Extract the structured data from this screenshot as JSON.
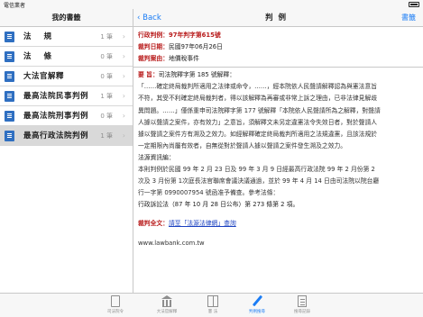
{
  "status": {
    "carrier": "電信業者",
    "time": ""
  },
  "sidebar": {
    "title": "我的書籤",
    "items": [
      {
        "label": "法規",
        "count": "1 筆"
      },
      {
        "label": "法條",
        "count": "0 筆"
      },
      {
        "label": "大法官解釋",
        "count": "0 筆"
      },
      {
        "label": "最高法院民事判例",
        "count": "1 筆"
      },
      {
        "label": "最高法院刑事判例",
        "count": "0 筆"
      },
      {
        "label": "最高行政法院判例",
        "count": "1 筆"
      }
    ]
  },
  "navbar": {
    "back": "Back",
    "title": "判例",
    "bookshelf": "書籤"
  },
  "case": {
    "type_label": "行政判例：",
    "number": "97年判字第615號",
    "date_label": "裁判日期：",
    "date": "民國97年06月26日",
    "cause_label": "裁判案由：",
    "cause": "地價稅事件",
    "gist_label": "要 旨：",
    "gist": "司法院釋字第 185 號解釋：",
    "para1": [
      "「……確定終局裁判所適用之法律或命令，……，經本院依人民聲請解釋認為與憲法意旨",
      "不符，其受不利確定終局裁判者，得以該解釋為再審或非常上訴之理由，已非法律見解歧",
      "異問題。……」僅係重申司法院釋字第 177 號解釋「本院依人民聲請所為之解釋，對聲請",
      "人據以聲請之案件，亦有效力」之意旨，須解釋文未另定違憲法令失效日者，對於聲請人",
      "據以聲請之案件方有溯及之效力。如經解釋確定終局裁判所適用之法規違憲，且該法規於",
      "一定期限內尚屬有效者，自無從對於聲請人據以聲請之案件發生溯及之效力。"
    ],
    "source_heading": "法源資訊編：",
    "para2": [
      "本則判例於民國 99 年 2 月 23 日及 99 年 3 月 9 日經最高行政法院 99 年 2 月份第 2",
      "次及 3 月份第 1次庭長法官聯席會議決議通過，並於 99 年 4 月 14 日由司法院以院台廳",
      "行一字第 0990007954 號函准予備查。參考法條："
    ],
    "ref_law": "行政訴訟法（87 年 10 月 28 日公布）第 273 條第 2 項。",
    "fulltext_label": "裁判全文：",
    "fulltext_link": "請至「法源法律網」查詢",
    "url": "www.lawbank.com.tw"
  },
  "tabbar": {
    "tabs": [
      {
        "label": "司法院令",
        "icon": "document-icon"
      },
      {
        "label": "大法官解釋",
        "icon": "bank-icon"
      },
      {
        "label": "憲 法",
        "icon": "book-icon"
      },
      {
        "label": "判例搜尋",
        "icon": "pen-icon"
      },
      {
        "label": "搜尋記錄",
        "icon": "list-icon"
      }
    ],
    "active_index": 3
  },
  "colors": {
    "accent": "#1a7cf5",
    "emphasis": "#b81b1b",
    "link": "#1a40c0"
  }
}
